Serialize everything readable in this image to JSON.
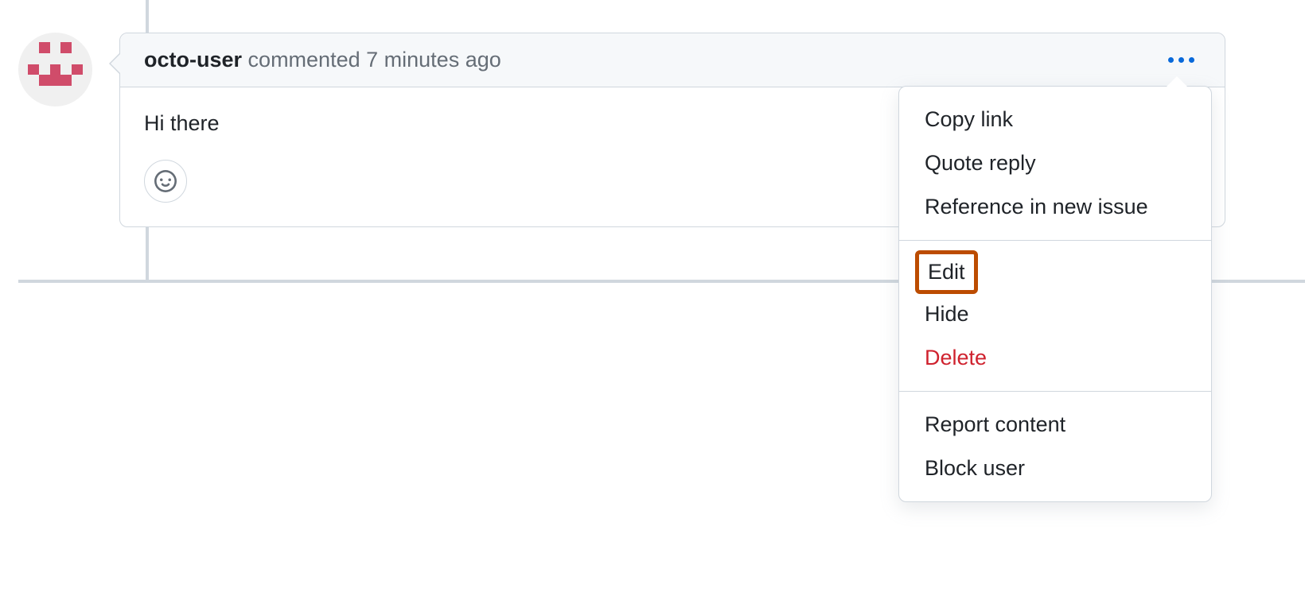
{
  "comment": {
    "username": "octo-user",
    "action_text": "commented",
    "timestamp": "7 minutes ago",
    "body": "Hi there"
  },
  "menu": {
    "group1": {
      "copy_link": "Copy link",
      "quote_reply": "Quote reply",
      "reference_issue": "Reference in new issue"
    },
    "group2": {
      "edit": "Edit",
      "hide": "Hide",
      "delete": "Delete"
    },
    "group3": {
      "report": "Report content",
      "block": "Block user"
    }
  }
}
